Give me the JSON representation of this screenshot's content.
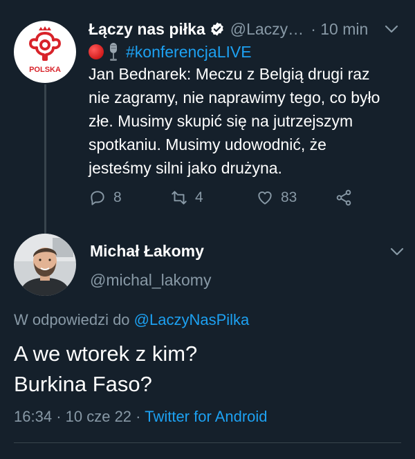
{
  "parent_tweet": {
    "account_name": "Łączy nas piłka",
    "handle": "@Laczy…",
    "time_separator": "·",
    "time": "10 min",
    "avatar_text": "POLSKA",
    "hashtag": "#konferencjaLIVE",
    "body": "Jan Bednarek: Meczu z Belgią drugi raz nie zagramy, nie naprawimy tego, co było złe. Musimy skupić się na jutrzejszym spotkaniu. Musimy udowodnić, że jesteśmy silni jako drużyna.",
    "replies": "8",
    "retweets": "4",
    "likes": "83"
  },
  "reply_tweet": {
    "display_name": "Michał Łakomy",
    "handle": "@michal_lakomy",
    "reply_prefix": "W odpowiedzi do",
    "reply_mention": "@LaczyNasPilka",
    "body": "A we wtorek z kim?\nBurkina Faso?",
    "time": "16:34",
    "date": "10 cze 22",
    "separator": "·",
    "client": "Twitter for Android"
  },
  "colors": {
    "background": "#15202b",
    "accent": "#1da1f2",
    "secondary_text": "#8899a6",
    "divider": "#38444d",
    "pzpn_red": "#d8232a"
  },
  "icons": {
    "verified": "verified-badge-icon",
    "chevron": "chevron-down-icon",
    "live": "red-circle-icon",
    "mic": "microphone-icon",
    "reply": "reply-icon",
    "retweet": "retweet-icon",
    "like": "heart-icon",
    "share": "share-icon"
  }
}
